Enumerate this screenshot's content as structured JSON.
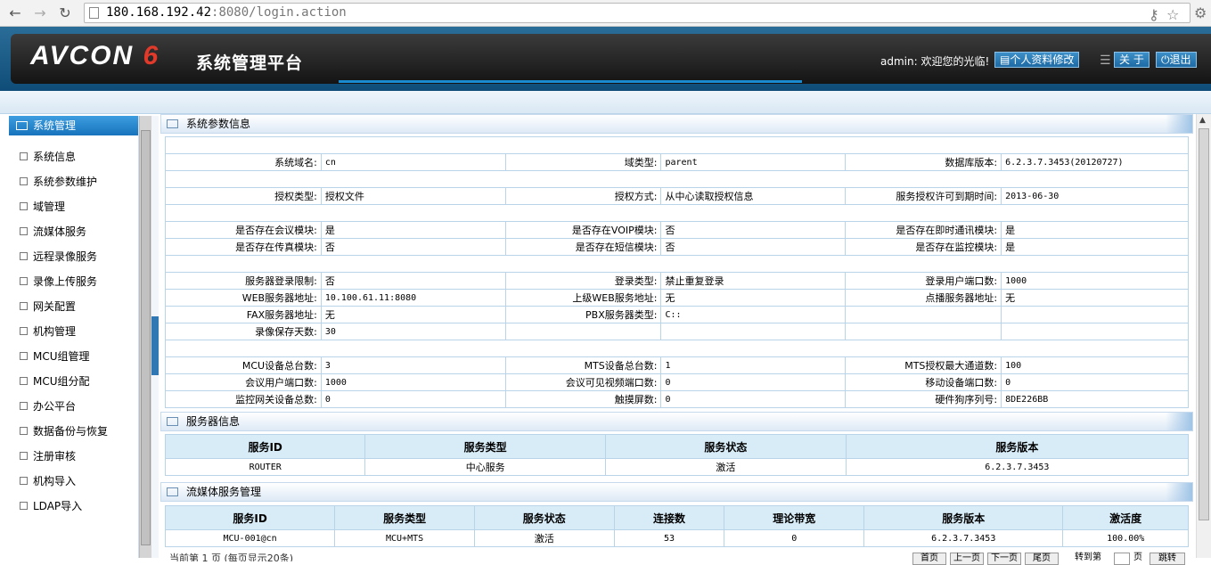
{
  "browser": {
    "url_host": "180.168.192.42",
    "url_rest": ":8080/login.action"
  },
  "header": {
    "logo": "AVCON",
    "logo_num": "6",
    "title": "系统管理平台",
    "welcome": "admin: 欢迎您的光临!",
    "profile_btn": "个人资料修改",
    "about_btn": "关 于",
    "logout_btn": "退出"
  },
  "sidebar": {
    "title": "系统管理",
    "items": [
      "系统信息",
      "系统参数维护",
      "域管理",
      "流媒体服务",
      "远程录像服务",
      "录像上传服务",
      "网关配置",
      "机构管理",
      "MCU组管理",
      "MCU组分配",
      "办公平台",
      "数据备份与恢复",
      "注册审核",
      "机构导入",
      "LDAP导入"
    ]
  },
  "params": {
    "title": "系统参数信息",
    "rows": [
      [],
      [
        [
          "系统域名:",
          "cn"
        ],
        [
          "域类型:",
          "parent"
        ],
        [
          "数据库版本:",
          "6.2.3.7.3453(20120727)"
        ]
      ],
      [],
      [
        [
          "授权类型:",
          "授权文件"
        ],
        [
          "授权方式:",
          "从中心读取授权信息"
        ],
        [
          "服务授权许可到期时间:",
          "2013-06-30"
        ]
      ],
      [],
      [
        [
          "是否存在会议模块:",
          "是"
        ],
        [
          "是否存在VOIP模块:",
          "否"
        ],
        [
          "是否存在即时通讯模块:",
          "是"
        ]
      ],
      [
        [
          "是否存在传真模块:",
          "否"
        ],
        [
          "是否存在短信模块:",
          "否"
        ],
        [
          "是否存在监控模块:",
          "是"
        ]
      ],
      [],
      [
        [
          "服务器登录限制:",
          "否"
        ],
        [
          "登录类型:",
          "禁止重复登录"
        ],
        [
          "登录用户端口数:",
          "1000"
        ]
      ],
      [
        [
          "WEB服务器地址:",
          "10.100.61.11:8080"
        ],
        [
          "上级WEB服务地址:",
          "无"
        ],
        [
          "点播服务器地址:",
          "无"
        ]
      ],
      [
        [
          "FAX服务器地址:",
          "无"
        ],
        [
          "PBX服务器类型:",
          "C::"
        ],
        [
          "",
          ""
        ]
      ],
      [
        [
          "录像保存天数:",
          "30"
        ],
        [
          "",
          ""
        ],
        [
          "",
          ""
        ]
      ],
      [],
      [
        [
          "MCU设备总台数:",
          "3"
        ],
        [
          "MTS设备总台数:",
          "1"
        ],
        [
          "MTS授权最大通道数:",
          "100"
        ]
      ],
      [
        [
          "会议用户端口数:",
          "1000"
        ],
        [
          "会议可见视频端口数:",
          "0"
        ],
        [
          "移动设备端口数:",
          "0"
        ]
      ],
      [
        [
          "监控网关设备总数:",
          "0"
        ],
        [
          "触摸屏数:",
          "0"
        ],
        [
          "硬件狗序列号:",
          "8DE226BB"
        ]
      ]
    ]
  },
  "servers": {
    "title": "服务器信息",
    "headers": [
      "服务ID",
      "服务类型",
      "服务状态",
      "服务版本"
    ],
    "rows": [
      [
        "ROUTER",
        "中心服务",
        "激活",
        "6.2.3.7.3453"
      ]
    ]
  },
  "streaming": {
    "title": "流媒体服务管理",
    "headers": [
      "服务ID",
      "服务类型",
      "服务状态",
      "连接数",
      "理论带宽",
      "服务版本",
      "激活度"
    ],
    "rows": [
      [
        "MCU-001@cn",
        "MCU+MTS",
        "激活",
        "53",
        "0",
        "6.2.3.7.3453",
        "100.00%"
      ]
    ]
  },
  "pager": {
    "text": "当前第 1 页 (每页显示20条)",
    "first": "首页",
    "prev": "上一页",
    "next": "下一页",
    "last": "尾页",
    "goto": "转到第",
    "page_unit": "页",
    "go": "跳转"
  }
}
